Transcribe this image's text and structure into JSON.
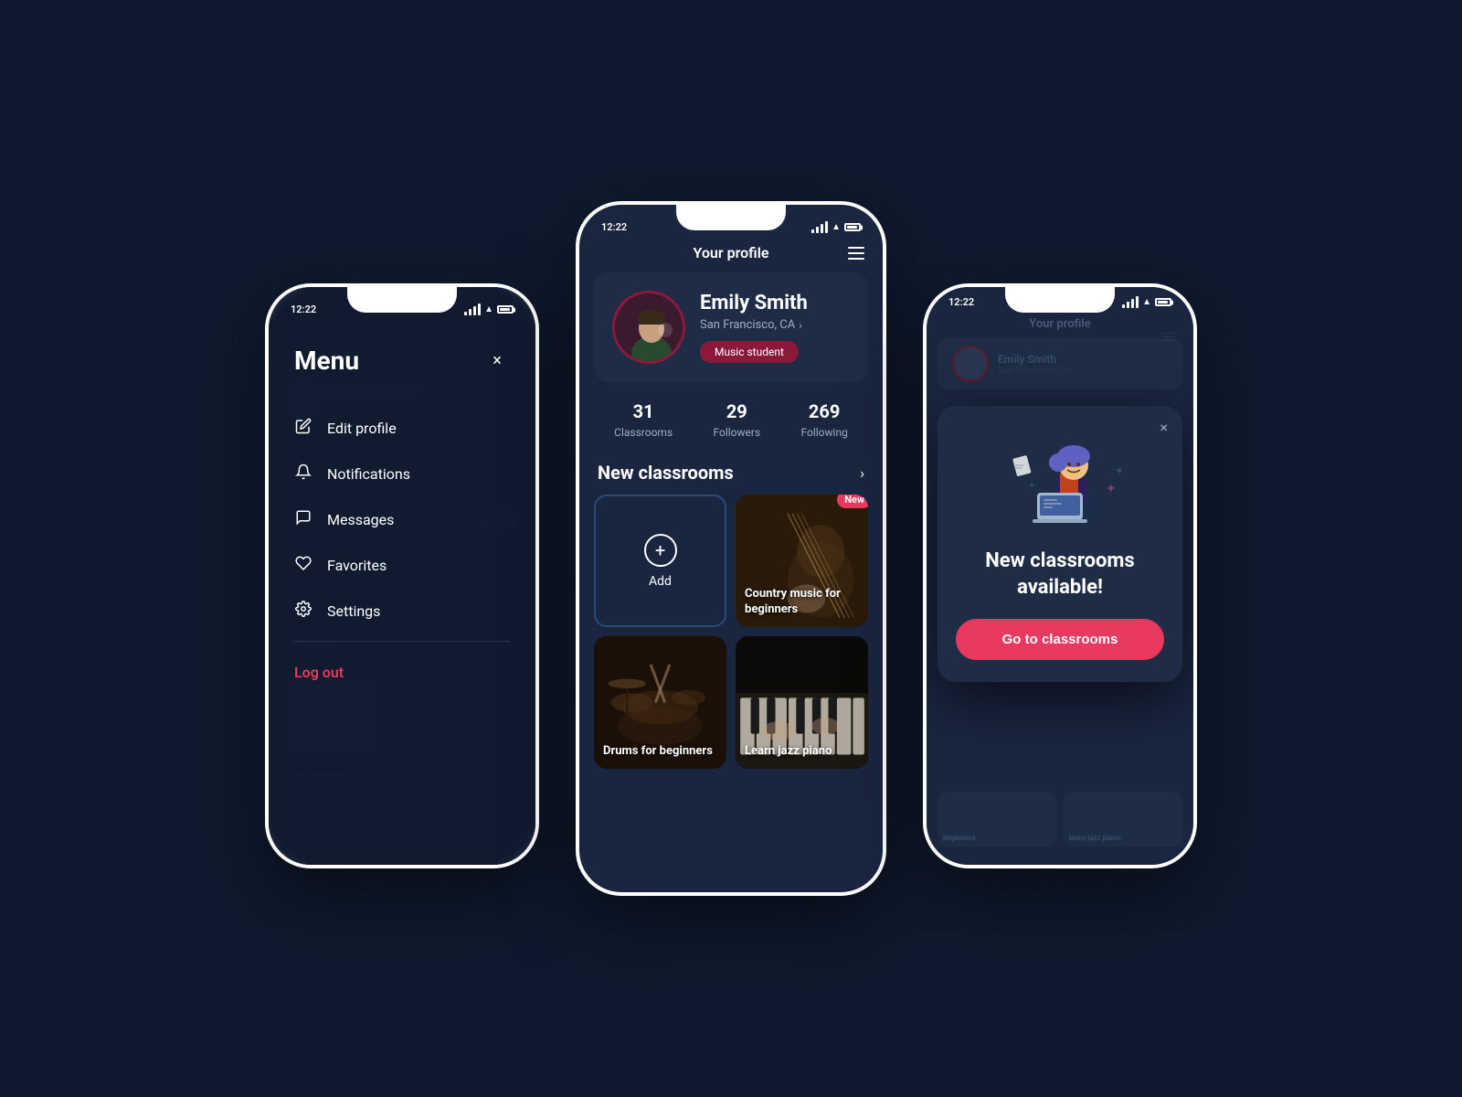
{
  "background": "#0f1a2e",
  "phone1": {
    "status_time": "12:22",
    "title": "Menu",
    "close_label": "×",
    "menu_items": [
      {
        "id": "edit-profile",
        "icon": "✏️",
        "label": "Edit profile"
      },
      {
        "id": "notifications",
        "icon": "🔔",
        "label": "Notifications"
      },
      {
        "id": "messages",
        "icon": "💬",
        "label": "Messages"
      },
      {
        "id": "favorites",
        "icon": "♡",
        "label": "Favorites"
      },
      {
        "id": "settings",
        "icon": "⚙️",
        "label": "Settings"
      }
    ],
    "logout_label": "Log out"
  },
  "phone2": {
    "status_time": "12:22",
    "header_title": "Your profile",
    "profile": {
      "name": "Emily Smith",
      "location": "San Francisco, CA",
      "tag": "Music student",
      "stats": {
        "classrooms": {
          "number": "31",
          "label": "Classrooms"
        },
        "followers": {
          "number": "29",
          "label": "Followers"
        },
        "following": {
          "number": "269",
          "label": "Following"
        }
      }
    },
    "classrooms_section": {
      "title": "New classrooms",
      "add_label": "Add",
      "cards": [
        {
          "id": "country-music",
          "label": "Country music for beginners",
          "is_new": true
        },
        {
          "id": "drums",
          "label": "Drums for beginners",
          "is_new": false
        },
        {
          "id": "jazz-piano",
          "label": "Learn jazz piano",
          "is_new": false
        }
      ],
      "new_badge": "New"
    }
  },
  "phone3": {
    "status_time": "12:22",
    "header_title": "Your profile",
    "notification": {
      "title": "New classrooms available!",
      "button_label": "Go to classrooms"
    },
    "bg_cards": [
      {
        "label": "beginners"
      },
      {
        "label": "learn jazz piano"
      }
    ]
  }
}
